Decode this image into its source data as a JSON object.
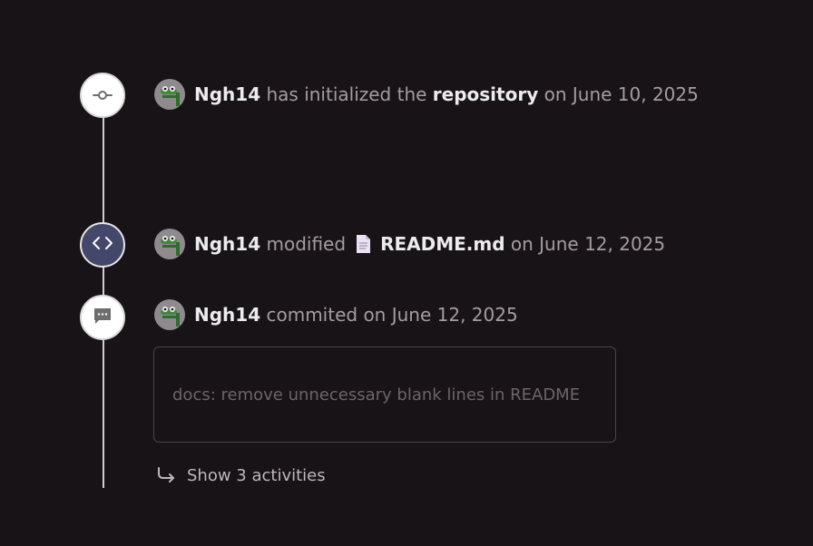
{
  "colors": {
    "background": "#181317",
    "muted_text": "#a39da3",
    "strong_text": "#ececec",
    "node_code_bg": "#43476a",
    "box_border": "#4a4449"
  },
  "events": [
    {
      "icon": "commit-icon",
      "user": "Ngh14",
      "action": "has initialized the",
      "object": "repository",
      "date": "on June 10, 2025"
    },
    {
      "icon": "code-icon",
      "user": "Ngh14",
      "action": "modified",
      "file_icon": "file-icon",
      "object": "README.md",
      "date": "on June 12, 2025"
    },
    {
      "icon": "comment-icon",
      "user": "Ngh14",
      "action": "commited on June 12, 2025",
      "message": "docs: remove unnecessary blank lines in README"
    }
  ],
  "show_more": {
    "icon": "reply-arrow-icon",
    "label": "Show 3 activities"
  }
}
